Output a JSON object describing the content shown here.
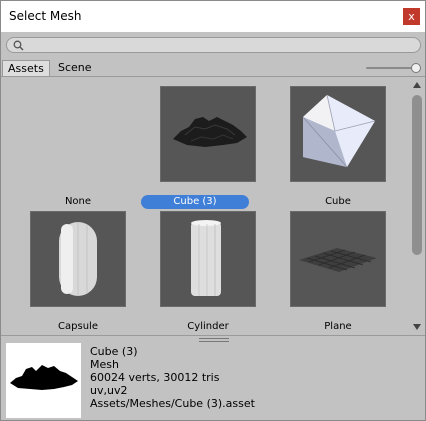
{
  "window": {
    "title": "Select Mesh",
    "close_glyph": "x"
  },
  "search": {
    "value": "",
    "placeholder": ""
  },
  "tabs": [
    {
      "label": "Assets",
      "active": true
    },
    {
      "label": "Scene",
      "active": false
    }
  ],
  "items": [
    {
      "label": "None",
      "icon": "none",
      "selected": false
    },
    {
      "label": "Cube (3)",
      "icon": "terrain-mesh-icon",
      "selected": true
    },
    {
      "label": "Cube",
      "icon": "cube-mesh-icon",
      "selected": false
    },
    {
      "label": "Capsule",
      "icon": "capsule-mesh-icon",
      "selected": false
    },
    {
      "label": "Cylinder",
      "icon": "cylinder-mesh-icon",
      "selected": false
    },
    {
      "label": "Plane",
      "icon": "plane-mesh-icon",
      "selected": false
    }
  ],
  "preview": {
    "name": "Cube (3)",
    "type": "Mesh",
    "stats": "60024 verts, 30012 tris",
    "uvs": "uv,uv2",
    "path": "Assets/Meshes/Cube (3).asset"
  },
  "colors": {
    "selection": "#3f7fd8",
    "close": "#c0392b",
    "panel": "#c2c2c2",
    "thumb_bg": "#565656"
  }
}
